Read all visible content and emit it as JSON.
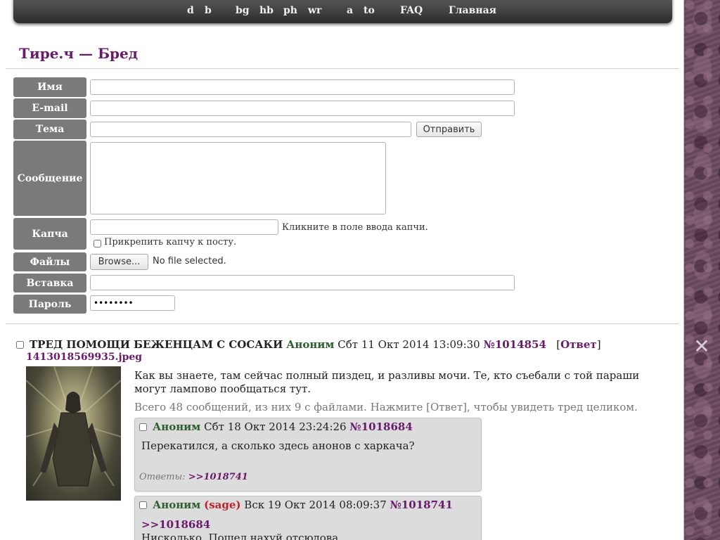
{
  "nav": {
    "links": [
      "d",
      "b",
      "bg",
      "hb",
      "ph",
      "wr",
      "a",
      "to",
      "FAQ",
      "Главная"
    ]
  },
  "board": {
    "title": "Тире.ч — Бред"
  },
  "form": {
    "name_label": "Имя",
    "email_label": "E-mail",
    "subject_label": "Тема",
    "message_label": "Сообщение",
    "captcha_label": "Капча",
    "files_label": "Файлы",
    "embed_label": "Вставка",
    "password_label": "Пароль",
    "submit_label": "Отправить",
    "captcha_hint": "Кликните в поле ввода капчи.",
    "attach_captcha_label": "Прикрепить капчу к посту.",
    "browse_label": "Browse...",
    "no_file_label": "No file selected.",
    "password_value": "••••••••"
  },
  "thread": {
    "subject": "ТРЕД ПОМОЩИ БЕЖЕНЦАМ С СОСАКИ",
    "name": "Аноним",
    "date": "Сбт 11 Окт 2014 13:09:30",
    "number": "№1014854",
    "reply_open": "[",
    "reply_label": "Ответ",
    "reply_close": "]",
    "filename": "1413018569935.jpeg",
    "text_line1": "Как вы знаете, там сейчас полный пиздец, и разливы мочи. Те, кто съебали с той параши",
    "text_line2": "могут лампово пообщаться тут.",
    "omitted": "Всего 48 сообщений, из них 9 с файлами. Нажмите [Ответ], чтобы увидеть тред целиком."
  },
  "replies": [
    {
      "name": "Аноним",
      "date": "Сбт 18 Окт 2014 23:24:26",
      "number": "№1018684",
      "text": "Перекатился, а сколько здесь анонов с харкача?",
      "answers_label": "Ответы:",
      "answers_link": ">>1018741"
    },
    {
      "name": "Аноним",
      "sage": "(sage)",
      "date": "Вск 19 Окт 2014 08:09:37",
      "number": "№1018741",
      "quote": ">>1018684",
      "text": "Нисколько. Пошел нахуй отсюдова."
    }
  ],
  "colors": {
    "accent": "#6a1a6a",
    "name": "#2e5f2e",
    "sage": "#c0222a",
    "label_bg": "#7a7a7a",
    "nav_bg": "#3a3a3a",
    "reply_bg": "#dcdcdc"
  },
  "icons": {
    "side_close": "close-icon"
  }
}
